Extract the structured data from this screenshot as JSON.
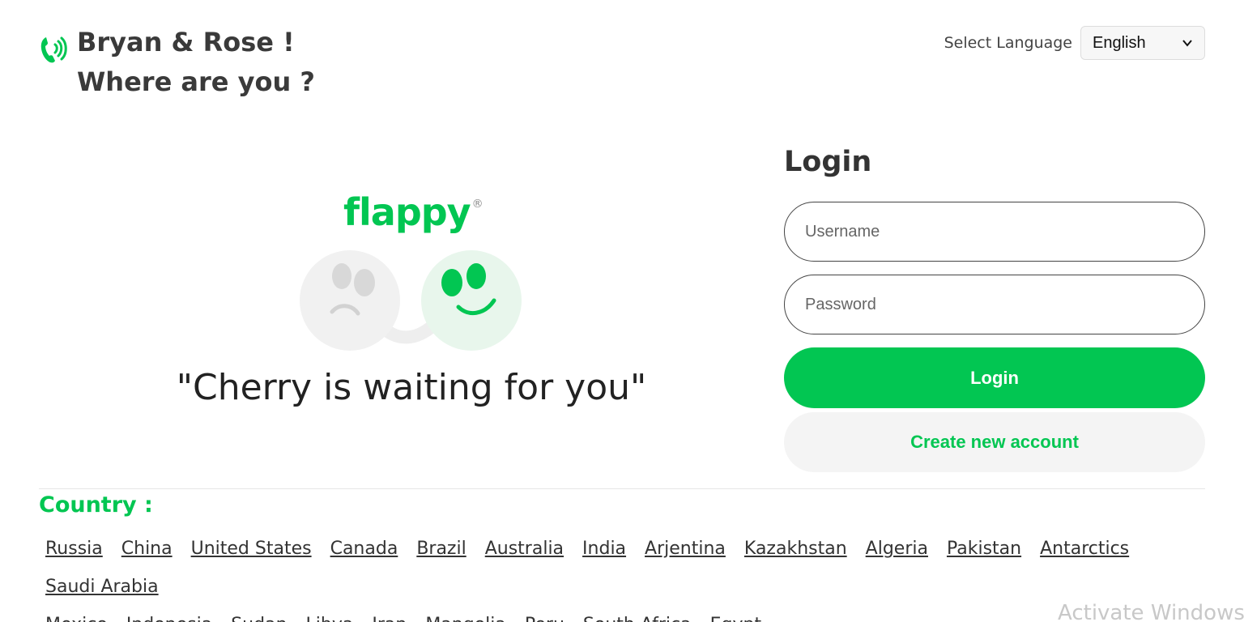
{
  "header": {
    "title_line1": "Bryan & Rose !",
    "title_line2": "Where are you ?",
    "logo_icon": "phone-ringing-icon"
  },
  "language": {
    "label": "Select Language",
    "selected": "English"
  },
  "hero": {
    "brand": "flappy",
    "registered": "®",
    "tagline": "\"Cherry is waiting for you\""
  },
  "login": {
    "title": "Login",
    "username_placeholder": "Username",
    "password_placeholder": "Password",
    "login_button": "Login",
    "create_button": "Create new account"
  },
  "countries": {
    "title": "Country :",
    "items": [
      "Russia",
      "China",
      "United States",
      "Canada",
      "Brazil",
      "Australia",
      "India",
      "Arjentina",
      "Kazakhstan",
      "Algeria",
      "Pakistan",
      "Antarctics",
      "Saudi Arabia",
      "Mexico",
      "Indonesia",
      "Sudan",
      "Libya",
      "Iran",
      "Mangolia",
      "Peru",
      "South Africa",
      "Egypt"
    ]
  },
  "watermark": "Activate Windows",
  "colors": {
    "accent": "#02c652",
    "text": "#333333"
  }
}
